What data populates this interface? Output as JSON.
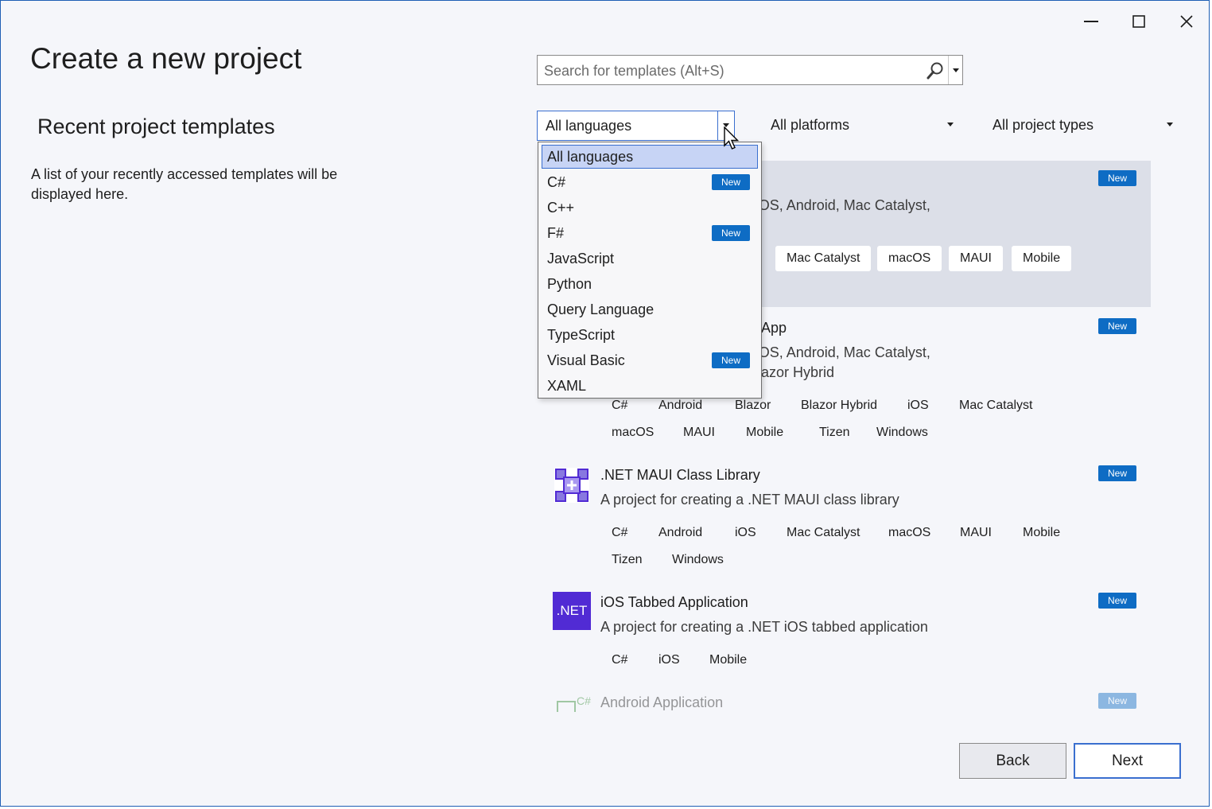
{
  "window": {
    "minimize_glyph": "—",
    "maximize_glyph": "☐",
    "close_glyph": "✕"
  },
  "page": {
    "title": "Create a new project",
    "recent_title": "Recent project templates",
    "recent_description": "A list of your recently accessed templates will be displayed here."
  },
  "search": {
    "placeholder": "Search for templates (Alt+S)",
    "value": ""
  },
  "filters": {
    "language": "All languages",
    "platform": "All platforms",
    "project_type": "All project types"
  },
  "language_dropdown": {
    "items": [
      {
        "label": "All languages",
        "badge": ""
      },
      {
        "label": "C#",
        "badge": "New"
      },
      {
        "label": "C++",
        "badge": ""
      },
      {
        "label": "F#",
        "badge": "New"
      },
      {
        "label": "JavaScript",
        "badge": ""
      },
      {
        "label": "Python",
        "badge": ""
      },
      {
        "label": "Query Language",
        "badge": ""
      },
      {
        "label": "TypeScript",
        "badge": ""
      },
      {
        "label": "Visual Basic",
        "badge": "New"
      },
      {
        "label": "XAML",
        "badge": ""
      }
    ]
  },
  "templates": [
    {
      "name": "",
      "description": "ET MAUI application for iOS, Android, Mac Catalyst,",
      "badge": "New",
      "tags": [
        "Mac Catalyst",
        "macOS",
        "MAUI",
        "Mobile"
      ]
    },
    {
      "name": "App",
      "description_line1": "ET MAUI application for iOS, Android, Mac Catalyst,",
      "description_line2": "azor Hybrid",
      "badge": "New",
      "tags_row1": [
        "C#",
        "Android",
        "Blazor",
        "Blazor Hybrid",
        "iOS",
        "Mac Catalyst"
      ],
      "tags_row2": [
        "macOS",
        "MAUI",
        "Mobile",
        "Tizen",
        "Windows"
      ]
    },
    {
      "name": ".NET MAUI Class Library",
      "description": "A project for creating a .NET MAUI class library",
      "badge": "New",
      "icon": "maui-class-library-icon",
      "tags_row1": [
        "C#",
        "Android",
        "iOS",
        "Mac Catalyst",
        "macOS",
        "MAUI",
        "Mobile"
      ],
      "tags_row2": [
        "Tizen",
        "Windows"
      ]
    },
    {
      "name": "iOS Tabbed Application",
      "description": "A project for creating a .NET iOS tabbed application",
      "badge": "New",
      "icon_text": ".NET",
      "tags": [
        "C#",
        "iOS",
        "Mobile"
      ]
    },
    {
      "name": "Android Application",
      "badge": "New",
      "icon_text": "C#"
    }
  ],
  "buttons": {
    "back": "Back",
    "next": "Next"
  },
  "colors": {
    "accent": "#3a6fcf",
    "badge": "#0e6cc4",
    "selected_row": "#dcdfe8",
    "net_purple": "#512bd4"
  }
}
